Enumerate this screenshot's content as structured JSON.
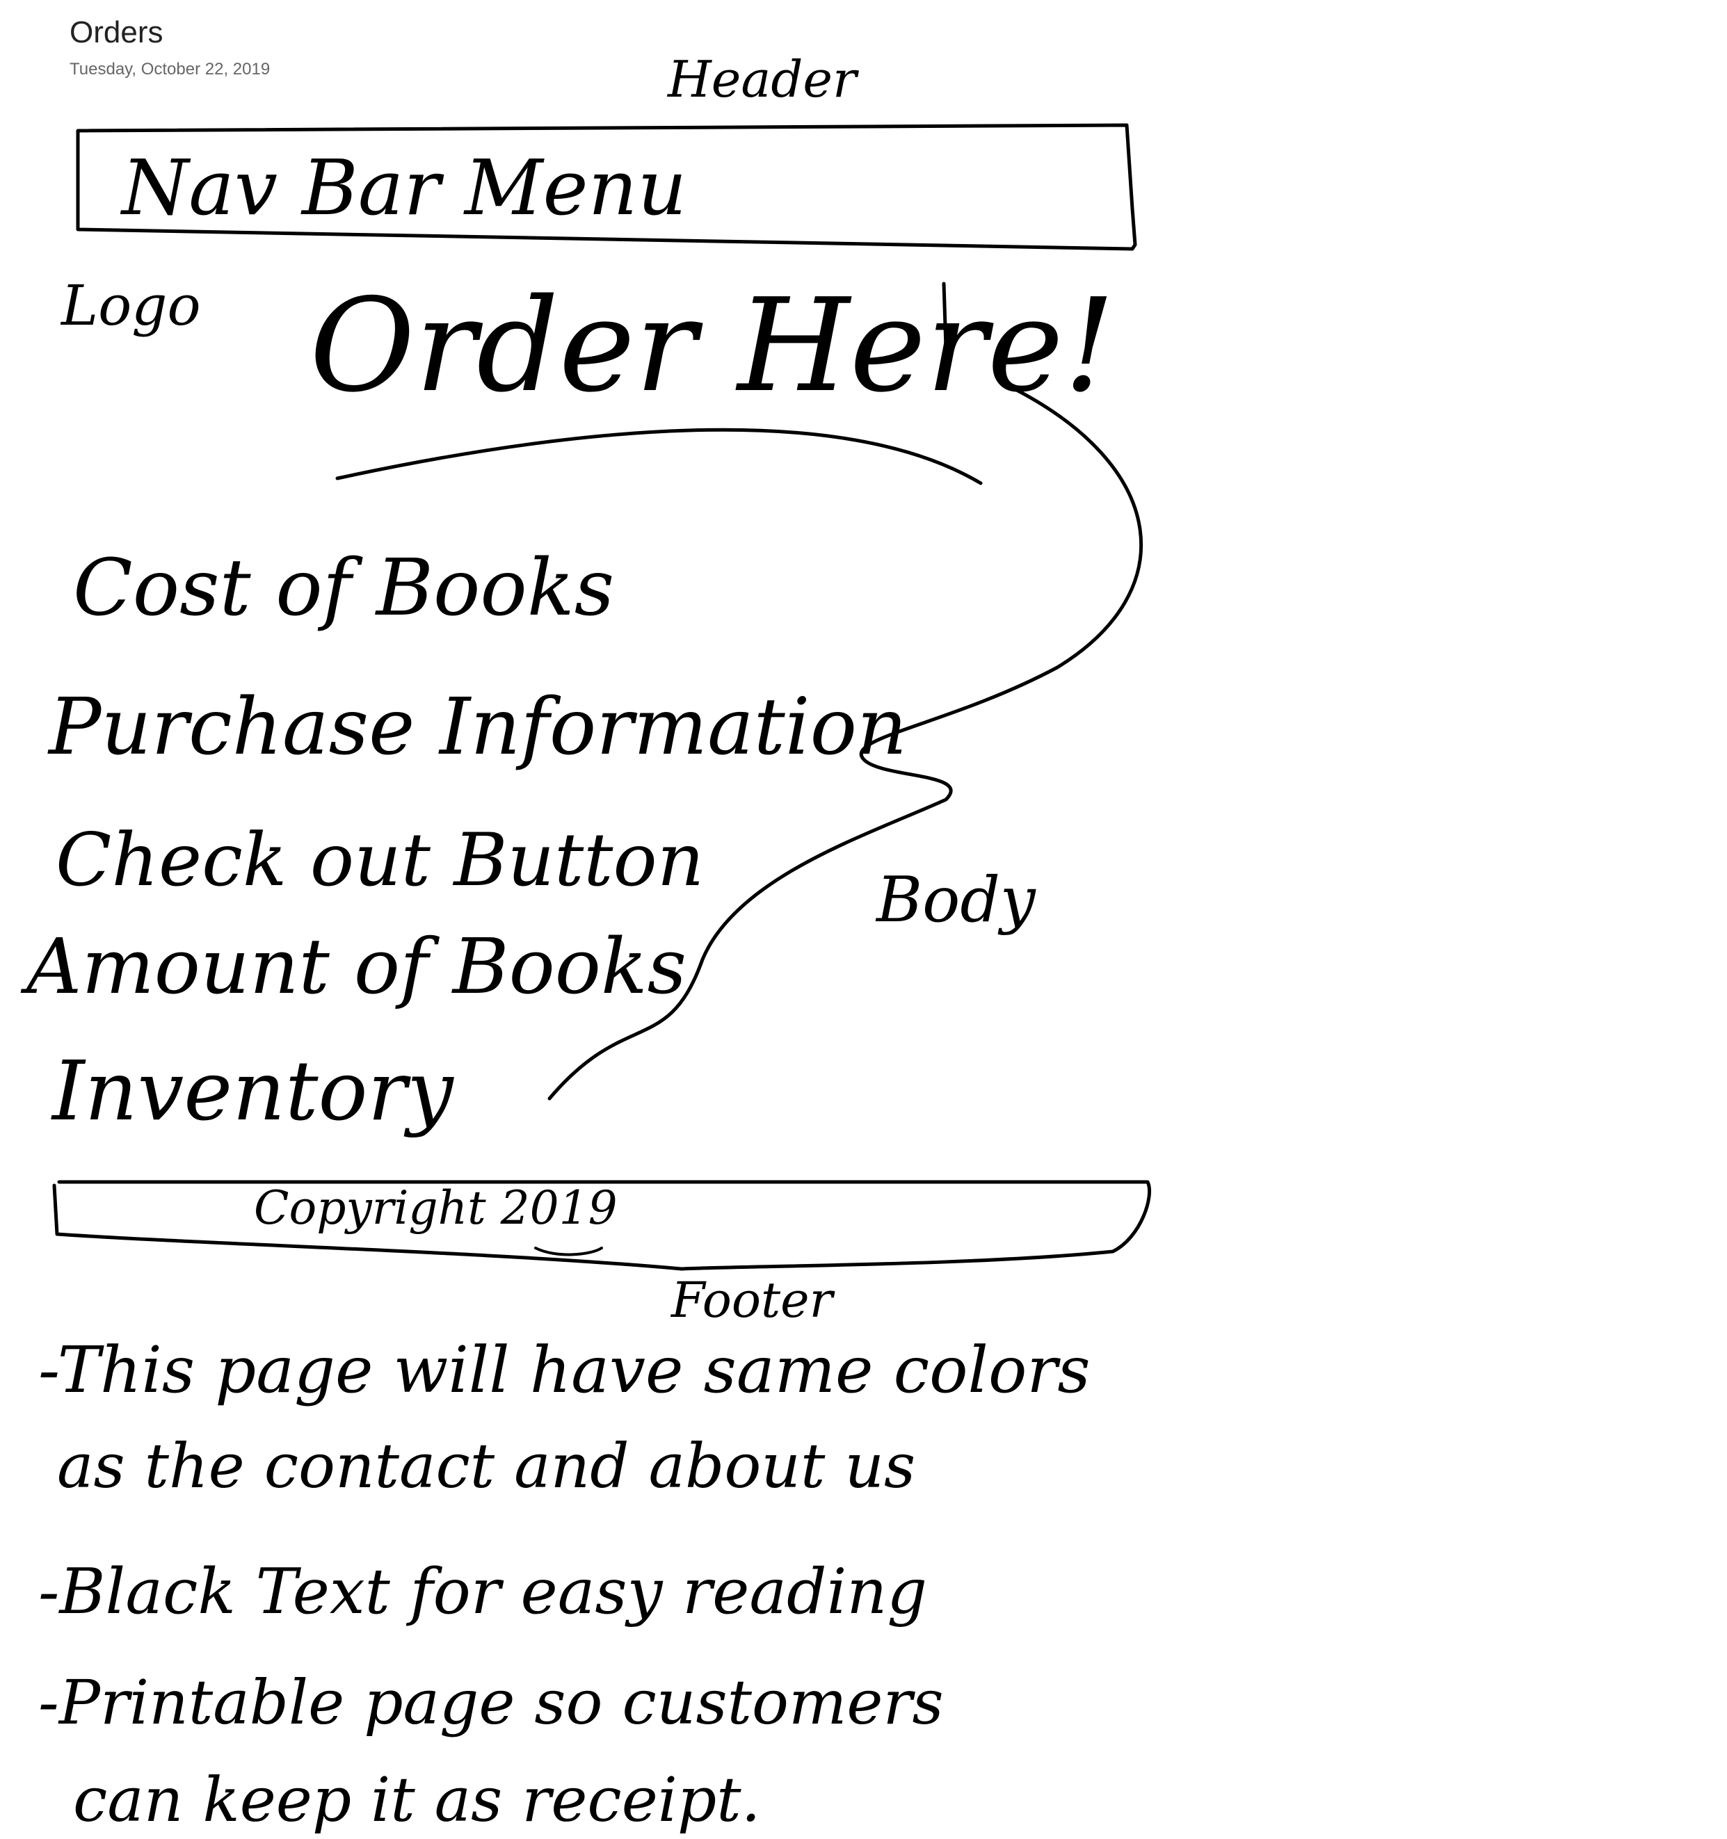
{
  "page": {
    "title": "Orders",
    "date": "Tuesday, October 22, 2019"
  },
  "sketch": {
    "header_label": "Header",
    "nav_bar": "Nav Bar Menu",
    "logo": "Logo",
    "headline": "Order Here!",
    "body_items": [
      "Cost of Books",
      "Purchase Information",
      "Check out Button",
      "Amount of Books",
      "Inventory"
    ],
    "body_label": "Body",
    "copyright": "Copyright 2019",
    "footer_label": "Footer"
  },
  "notes": [
    "-This page will have same colors",
    "as the contact and about us",
    "-Black Text for easy reading",
    "-Printable page so customers",
    "can keep it as receipt."
  ],
  "colors": {
    "ink": "#000000",
    "title": "#222222",
    "date": "#666666",
    "background": "#ffffff"
  }
}
